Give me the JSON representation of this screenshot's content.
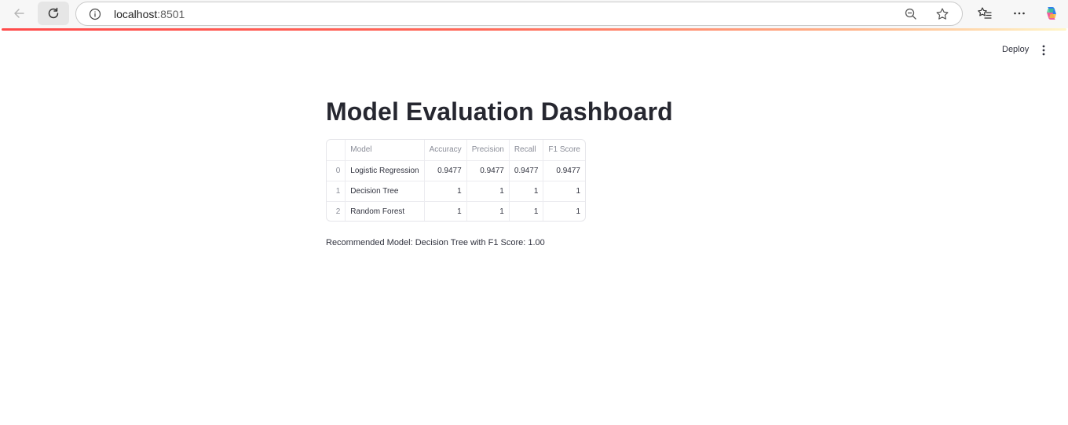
{
  "browser": {
    "url_host": "localhost",
    "url_port": ":8501"
  },
  "app": {
    "deploy_label": "Deploy",
    "title": "Model Evaluation Dashboard"
  },
  "table": {
    "columns": [
      "",
      "Model",
      "Accuracy",
      "Precision",
      "Recall",
      "F1 Score"
    ],
    "rows": [
      {
        "index": "0",
        "model": "Logistic Regression",
        "accuracy": "0.9477",
        "precision": "0.9477",
        "recall": "0.9477",
        "f1": "0.9477"
      },
      {
        "index": "1",
        "model": "Decision Tree",
        "accuracy": "1",
        "precision": "1",
        "recall": "1",
        "f1": "1"
      },
      {
        "index": "2",
        "model": "Random Forest",
        "accuracy": "1",
        "precision": "1",
        "recall": "1",
        "f1": "1"
      }
    ]
  },
  "recommendation": "Recommended Model: Decision Tree with F1 Score: 1.00",
  "icons": {
    "back": "arrow-left-icon",
    "reload": "reload-icon",
    "info": "info-icon",
    "zoom": "zoom-out-icon",
    "favorite": "star-icon",
    "favorites_bar": "favorites-icon",
    "more": "more-icon",
    "copilot": "copilot-icon",
    "app_menu": "kebab-menu-icon"
  },
  "colors": {
    "accent": "#ff4b4b",
    "text": "#31333f"
  }
}
